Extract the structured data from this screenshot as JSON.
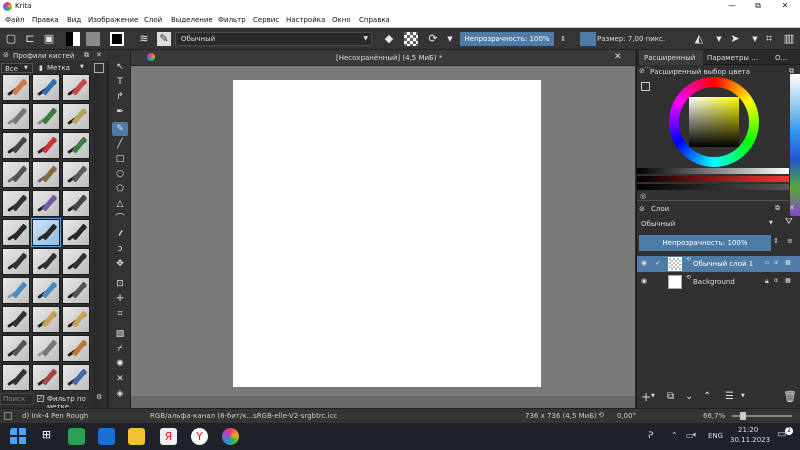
{
  "window": {
    "title": "Krita",
    "minimize": "—",
    "restore": "⧉",
    "close": "✕"
  },
  "menu": [
    "Файл",
    "Правка",
    "Вид",
    "Изображение",
    "Слой",
    "Выделение",
    "Фильтр",
    "Сервис",
    "Настройка",
    "Окно",
    "Справка"
  ],
  "toolbar": {
    "blend_mode": "Обычный",
    "opacity_label": "Непрозрачность: 100%",
    "opacity_value": 100,
    "size_label": "Размер: 7,00 пикс."
  },
  "brush_panel": {
    "title": "Профили кистей",
    "filter_all": "Все",
    "tag_label": "Метка",
    "search_placeholder": "Поиск",
    "filter_by_tag": "Фильтр по метке"
  },
  "document": {
    "tab_title": "[Несохранённый]  (4,5 МиБ) *"
  },
  "color_panel": {
    "tab1": "Расширенный ...",
    "tab2": "Параметры ...",
    "tab3": "О...",
    "title": "Расширенный выбор цвета"
  },
  "layers_panel": {
    "title": "Слои",
    "blend_mode": "Обычный",
    "opacity_label": "Непрозрачность:  100%",
    "layers": [
      {
        "name": "Обычный слой 1",
        "selected": true
      },
      {
        "name": "Background",
        "selected": false
      }
    ]
  },
  "status": {
    "brush_name": "d) Ink-4 Pen Rough",
    "color_profile": "RGB/альфа-канал (8-бит/к...sRGB-elle-V2-srgbtrc.icc",
    "image_size": "736 x 736 (4,5 МиБ)",
    "rotation": "0,00°",
    "zoom": "66,7%"
  },
  "taskbar": {
    "language": "ENG",
    "time": "21:20",
    "date": "30.11.2023",
    "notification_count": "2"
  },
  "colors": {
    "accent": "#4f7ba7",
    "canvas_bg": "#7a7a7a",
    "panel_bg": "#313131"
  }
}
